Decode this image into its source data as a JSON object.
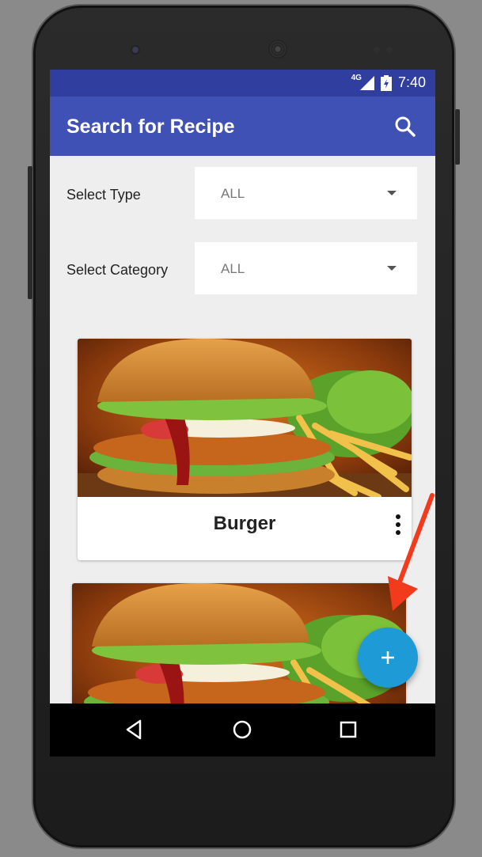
{
  "status_bar": {
    "network": "4G",
    "time": "7:40",
    "color": "#303f9f"
  },
  "app_bar": {
    "title": "Search for Recipe",
    "search_icon": "search-icon",
    "color": "#3f51b5"
  },
  "filters": {
    "type": {
      "label": "Select Type",
      "value": "ALL"
    },
    "category": {
      "label": "Select Category",
      "value": "ALL"
    }
  },
  "recipes": [
    {
      "title": "Burger",
      "image": "burger-photo",
      "menu_icon": "more-vert-icon"
    },
    {
      "title": "",
      "image": "burger-photo"
    }
  ],
  "fab": {
    "icon": "plus-icon",
    "color": "#1e9ad6"
  },
  "annotation": {
    "icon": "red-arrow",
    "color": "#f23a1c"
  },
  "nav_bar": {
    "buttons": [
      "back-icon",
      "home-icon",
      "recents-icon"
    ]
  }
}
